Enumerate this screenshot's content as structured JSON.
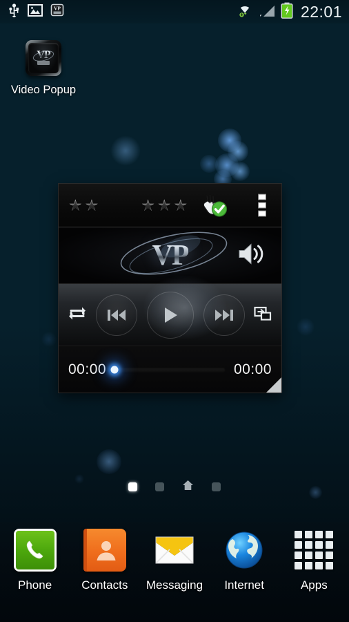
{
  "statusbar": {
    "icons_left": [
      {
        "name": "usb-icon",
        "glyph": "USB"
      },
      {
        "name": "gallery-image-icon",
        "glyph": "Image"
      },
      {
        "name": "vp-notification-icon",
        "glyph": "VP"
      }
    ],
    "icons_right": [
      {
        "name": "wifi-icon",
        "glyph": "WiFi"
      },
      {
        "name": "signal-bars-icon",
        "glyph": "Signal"
      },
      {
        "name": "battery-charging-icon",
        "glyph": "Battery"
      }
    ],
    "clock": "22:01",
    "clock_color": "#eef4f6",
    "battery_color": "#63c91f"
  },
  "homescreen": {
    "shortcut": {
      "label": "Video Popup",
      "icon_name": "video-popup-app-icon",
      "icon_text": "VP"
    },
    "page_indicator": {
      "pages": [
        {
          "name": "page-dot-1",
          "state": "active"
        },
        {
          "name": "page-dot-2",
          "state": "dim"
        },
        {
          "name": "page-dot-home",
          "state": "home"
        },
        {
          "name": "page-dot-4",
          "state": "dim"
        }
      ]
    }
  },
  "widget": {
    "title": "Video Popup player widget",
    "rating_left": {
      "name": "rating-stars-left",
      "count": 2
    },
    "rating_right": {
      "name": "rating-stars-right",
      "count": 3
    },
    "touch_check_icon": "touch-check-icon",
    "overflow_menu_icon": "overflow-menu-icon",
    "logo_text": "VP",
    "volume_icon": "volume-speaker-icon",
    "controls": [
      {
        "name": "repeat-button",
        "glyph": "repeat"
      },
      {
        "name": "previous-button",
        "glyph": "prev"
      },
      {
        "name": "play-button",
        "glyph": "play"
      },
      {
        "name": "next-button",
        "glyph": "next"
      },
      {
        "name": "popup-window-button",
        "glyph": "popup"
      }
    ],
    "time_elapsed": "00:00",
    "time_total": "00:00",
    "seek_progress_percent": 0,
    "seek_thumb_glow_color": "#3c8ceb",
    "resize_handle_name": "widget-resize-handle"
  },
  "dock": {
    "items": [
      {
        "label": "Phone",
        "icon": "phone-icon"
      },
      {
        "label": "Contacts",
        "icon": "contacts-icon"
      },
      {
        "label": "Messaging",
        "icon": "messaging-icon"
      },
      {
        "label": "Internet",
        "icon": "internet-globe-icon"
      },
      {
        "label": "Apps",
        "icon": "apps-grid-icon"
      }
    ]
  },
  "theme": {
    "wallpaper_top_color": "#1a5a68",
    "wallpaper_bottom_color": "#030f16",
    "bokeh_color": "#4a96e8"
  }
}
